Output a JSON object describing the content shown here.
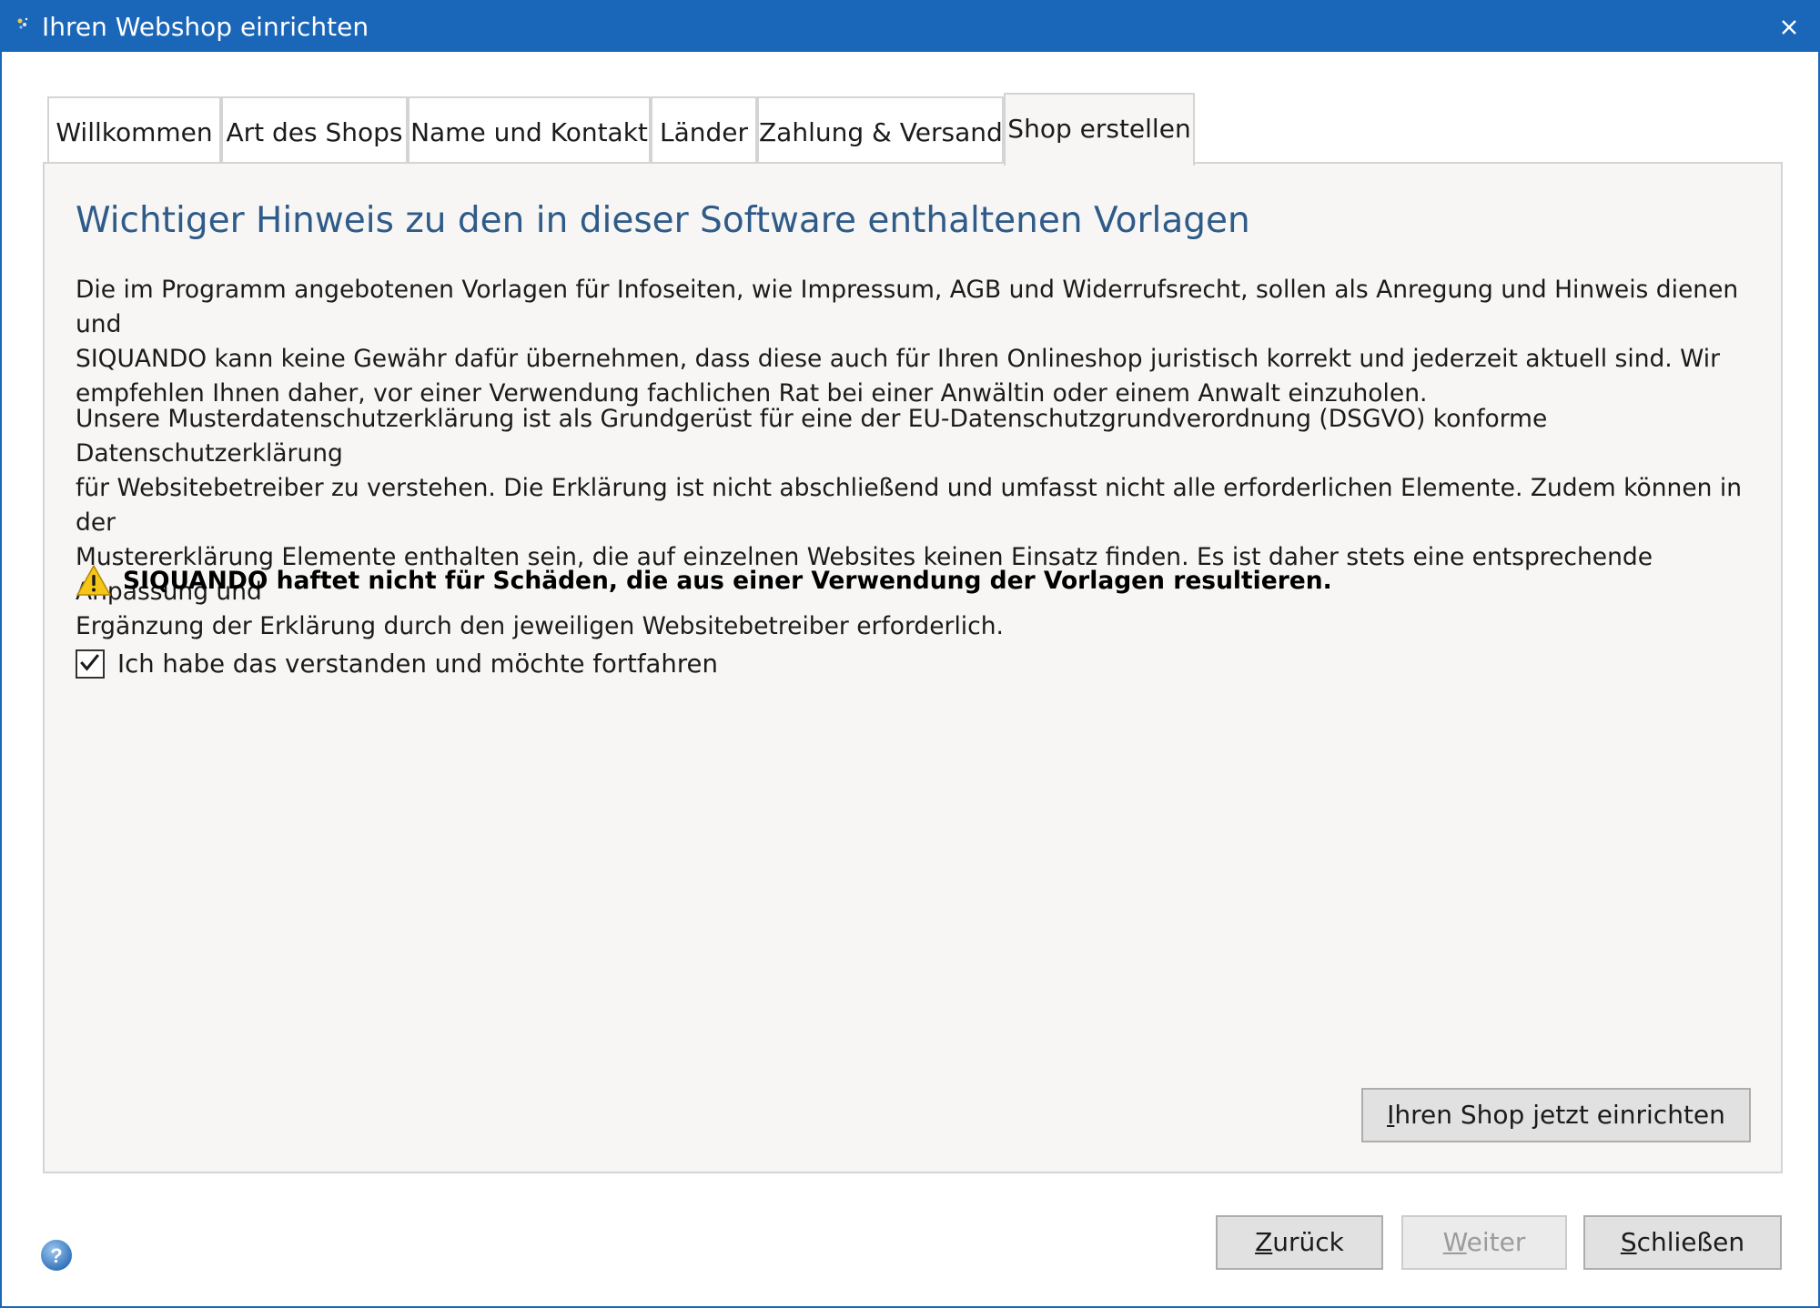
{
  "window": {
    "title": "Ihren Webshop einrichten",
    "icon": "app-icon",
    "close_icon": "close-icon"
  },
  "tabs": [
    {
      "label": "Willkommen",
      "active": false
    },
    {
      "label": "Art des Shops",
      "active": false
    },
    {
      "label": "Name und Kontakt",
      "active": false
    },
    {
      "label": "Länder",
      "active": false
    },
    {
      "label": "Zahlung & Versand",
      "active": false
    },
    {
      "label": "Shop erstellen",
      "active": true
    }
  ],
  "content": {
    "heading": "Wichtiger Hinweis zu den in dieser Software enthaltenen Vorlagen",
    "paragraph1": "Die im Programm angebotenen Vorlagen für Infoseiten, wie Impressum, AGB und Widerrufsrecht, sollen als Anregung und Hinweis dienen und\nSIQUANDO kann keine Gewähr dafür übernehmen, dass diese auch für Ihren Onlineshop juristisch korrekt und jederzeit aktuell sind. Wir\nempfehlen Ihnen daher, vor einer Verwendung fachlichen Rat bei einer Anwältin oder einem Anwalt einzuholen.",
    "paragraph2": "Unsere Musterdatenschutzerklärung ist als Grundgerüst für eine der EU-Datenschutzgrundverordnung (DSGVO) konforme Datenschutzerklärung\nfür Websitebetreiber zu verstehen. Die Erklärung ist nicht abschließend und umfasst nicht alle erforderlichen Elemente. Zudem können in der\nMustererklärung Elemente enthalten sein, die auf einzelnen Websites keinen Einsatz finden. Es ist daher stets eine entsprechende Anpassung und\nErgänzung der Erklärung durch den jeweiligen Websitebetreiber erforderlich.",
    "warning": "SIQUANDO haftet nicht für Schäden, die aus einer Verwendung der Vorlagen resultieren.",
    "warning_icon": "warning-icon",
    "checkbox_label": "Ich habe das verstanden und möchte fortfahren",
    "checkbox_checked": true,
    "setup_button": {
      "accel": "I",
      "rest": "hren Shop jetzt einrichten"
    }
  },
  "footer": {
    "help_icon": "help-icon",
    "back_button": {
      "accel": "Z",
      "rest": "urück"
    },
    "next_button": {
      "accel": "W",
      "rest": "eiter",
      "enabled": false
    },
    "close_button": {
      "accel": "S",
      "rest": "chließen"
    }
  },
  "colors": {
    "titlebar": "#1a66b8",
    "heading": "#2f5b89",
    "panel_bg": "#f7f6f5",
    "button_bg": "#e1e1e1",
    "warning_yellow": "#f5c518"
  }
}
